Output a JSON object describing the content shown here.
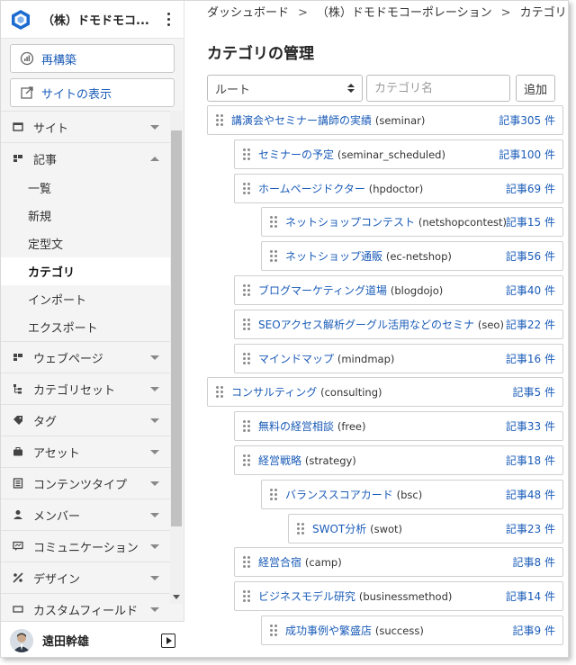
{
  "sidebar": {
    "site_name": "（株）ドモドモコ...",
    "rebuild_label": "再構築",
    "view_site_label": "サイトの表示",
    "menu": [
      {
        "id": "site",
        "label": "サイト",
        "icon": "window-icon",
        "open": false
      },
      {
        "id": "entry",
        "label": "記事",
        "icon": "entries-icon",
        "open": true,
        "sub": [
          {
            "label": "一覧",
            "active": false
          },
          {
            "label": "新規",
            "active": false
          },
          {
            "label": "定型文",
            "active": false
          },
          {
            "label": "カテゴリ",
            "active": true
          },
          {
            "label": "インポート",
            "active": false
          },
          {
            "label": "エクスポート",
            "active": false
          }
        ]
      },
      {
        "id": "webpage",
        "label": "ウェブページ",
        "icon": "pages-icon",
        "open": false
      },
      {
        "id": "category-set",
        "label": "カテゴリセット",
        "icon": "tree-icon",
        "open": false
      },
      {
        "id": "tag",
        "label": "タグ",
        "icon": "tag-icon",
        "open": false
      },
      {
        "id": "asset",
        "label": "アセット",
        "icon": "briefcase-icon",
        "open": false
      },
      {
        "id": "content-type",
        "label": "コンテンツタイプ",
        "icon": "content-icon",
        "open": false
      },
      {
        "id": "member",
        "label": "メンバー",
        "icon": "user-icon",
        "open": false
      },
      {
        "id": "communication",
        "label": "コミュニケーション",
        "icon": "comment-icon",
        "open": false
      },
      {
        "id": "design",
        "label": "デザイン",
        "icon": "design-icon",
        "open": false
      },
      {
        "id": "custom-field",
        "label": "カスタムフィールド",
        "icon": "field-icon",
        "open": false
      }
    ],
    "user_name": "遠田幹雄"
  },
  "breadcrumb": [
    "ダッシュボード",
    "（株）ドモドモコーポレーション",
    "カテゴリ"
  ],
  "page_title": "カテゴリの管理",
  "controls": {
    "select_value": "ルート",
    "input_placeholder": "カテゴリ名",
    "add_label": "追加"
  },
  "categories": [
    {
      "label": "講演会やセミナー講師の実績",
      "slug": "(seminar)",
      "count": "記事305 件",
      "depth": 0
    },
    {
      "label": "セミナーの予定",
      "slug": "(seminar_scheduled)",
      "count": "記事100 件",
      "depth": 1
    },
    {
      "label": "ホームページドクター",
      "slug": "(hpdoctor)",
      "count": "記事69 件",
      "depth": 1
    },
    {
      "label": "ネットショップコンテスト",
      "slug": "(netshopcontest)",
      "count": "記事15 件",
      "depth": 2
    },
    {
      "label": "ネットショップ通販",
      "slug": "(ec-netshop)",
      "count": "記事56 件",
      "depth": 2
    },
    {
      "label": "ブログマーケティング道場",
      "slug": "(blogdojo)",
      "count": "記事40 件",
      "depth": 1
    },
    {
      "label": "SEOアクセス解析グーグル活用などのセミナ",
      "slug": "(seo)",
      "count": "記事22 件",
      "depth": 1
    },
    {
      "label": "マインドマップ",
      "slug": "(mindmap)",
      "count": "記事16 件",
      "depth": 1
    },
    {
      "label": "コンサルティング",
      "slug": "(consulting)",
      "count": "記事5 件",
      "depth": 0
    },
    {
      "label": "無料の経営相談",
      "slug": "(free)",
      "count": "記事33 件",
      "depth": 1
    },
    {
      "label": "経営戦略",
      "slug": "(strategy)",
      "count": "記事18 件",
      "depth": 1
    },
    {
      "label": "バランススコアカード",
      "slug": "(bsc)",
      "count": "記事48 件",
      "depth": 2
    },
    {
      "label": "SWOT分析",
      "slug": "(swot)",
      "count": "記事23 件",
      "depth": 3
    },
    {
      "label": "経営合宿",
      "slug": "(camp)",
      "count": "記事8 件",
      "depth": 1
    },
    {
      "label": "ビジネスモデル研究",
      "slug": "(businessmethod)",
      "count": "記事14 件",
      "depth": 1
    },
    {
      "label": "成功事例や繁盛店",
      "slug": "(success)",
      "count": "記事9 件",
      "depth": 2
    }
  ],
  "colors": {
    "link": "#1b5cb8",
    "logo_blue": "#1c6bd0"
  }
}
